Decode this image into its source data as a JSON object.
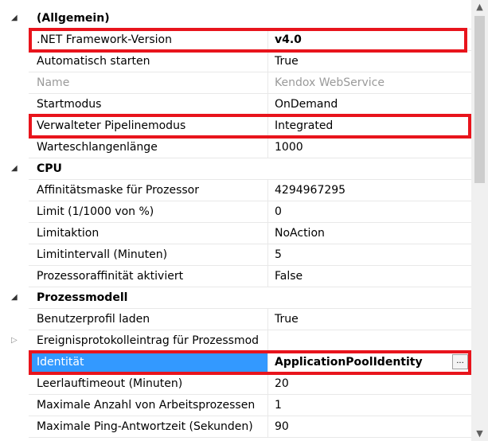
{
  "property_grid": {
    "rows": [
      {
        "kind": "cat",
        "toggle": "◢",
        "label": "(Allgemein)"
      },
      {
        "kind": "prop",
        "label": ".NET Framework-Version",
        "value": "v4.0",
        "bold": true
      },
      {
        "kind": "prop",
        "label": "Automatisch starten",
        "value": "True"
      },
      {
        "kind": "prop",
        "label": "Name",
        "value": "Kendox WebService",
        "disabled": true
      },
      {
        "kind": "prop",
        "label": "Startmodus",
        "value": "OnDemand"
      },
      {
        "kind": "prop",
        "label": "Verwalteter Pipelinemodus",
        "value": "Integrated"
      },
      {
        "kind": "prop",
        "label": "Warteschlangenlänge",
        "value": "1000"
      },
      {
        "kind": "cat",
        "toggle": "◢",
        "label": "CPU"
      },
      {
        "kind": "prop",
        "label": "Affinitätsmaske für Prozessor",
        "value": "4294967295"
      },
      {
        "kind": "prop",
        "label": "Limit (1/1000 von %)",
        "value": "0"
      },
      {
        "kind": "prop",
        "label": "Limitaktion",
        "value": "NoAction"
      },
      {
        "kind": "prop",
        "label": "Limitintervall (Minuten)",
        "value": "5"
      },
      {
        "kind": "prop",
        "label": "Prozessoraffinität aktiviert",
        "value": "False"
      },
      {
        "kind": "cat",
        "toggle": "◢",
        "label": "Prozessmodell"
      },
      {
        "kind": "prop",
        "label": "Benutzerprofil laden",
        "value": "True"
      },
      {
        "kind": "prop",
        "label": "Ereignisprotokolleintrag für Prozessmod",
        "value": "",
        "toggle": "▷",
        "expandable": true
      },
      {
        "kind": "prop",
        "label": "Identität",
        "value": "ApplicationPoolIdentity",
        "selected": true,
        "button": "..."
      },
      {
        "kind": "prop",
        "label": "Leerlauftimeout (Minuten)",
        "value": "20"
      },
      {
        "kind": "prop",
        "label": "Maximale Anzahl von Arbeitsprozessen",
        "value": "1"
      },
      {
        "kind": "prop",
        "label": "Maximale Ping-Antwortzeit (Sekunden)",
        "value": "90"
      }
    ],
    "highlight_color": "#e8141c",
    "selection_color": "#3399ff"
  },
  "scrollbar": {
    "up_icon": "▲",
    "down_icon": "▼"
  }
}
